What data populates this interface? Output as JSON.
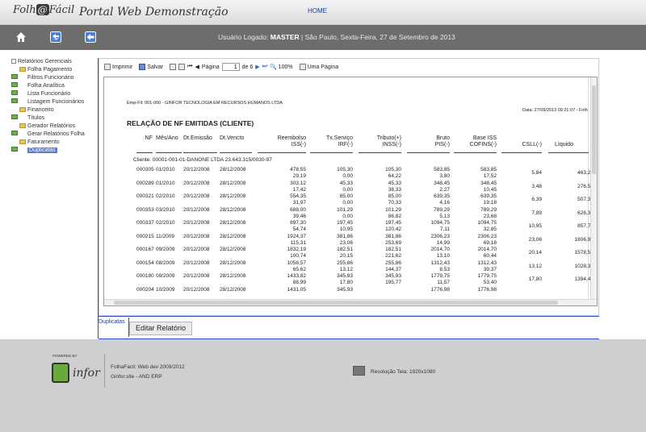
{
  "header": {
    "logo_left": "Folh",
    "logo_at": "@",
    "logo_right": "Fácil",
    "title": "Portal Web Demonstração",
    "home_label": "HOME"
  },
  "toolbar": {
    "logged_label": "Usuário Logado:",
    "user": "MASTER",
    "status_rest": "| São Paulo, Sexta-Feira, 27 de Setembro de 2013"
  },
  "sidebar": {
    "items": [
      {
        "label": "Relatórios Gerenciais",
        "level": 0,
        "icon": "report-icon"
      },
      {
        "label": "Folha Pagamento",
        "level": 1,
        "icon": "folder-icon"
      },
      {
        "label": "Filtros Funcionário",
        "level": 2,
        "icon": "doc-icon"
      },
      {
        "label": "Folha Analítica",
        "level": 2,
        "icon": "doc-icon"
      },
      {
        "label": "Lista Funcionário",
        "level": 2,
        "icon": "doc-icon"
      },
      {
        "label": "Listagem Funcionários",
        "level": 2,
        "icon": "doc-icon"
      },
      {
        "label": "Financeiro",
        "level": 1,
        "icon": "folder-icon"
      },
      {
        "label": "Títulos",
        "level": 2,
        "icon": "doc-icon"
      },
      {
        "label": "Gerador Relatórios",
        "level": 1,
        "icon": "folder-icon"
      },
      {
        "label": "Gerar Relatórios Folha",
        "level": 2,
        "icon": "doc-icon"
      },
      {
        "label": "Faturamento",
        "level": 1,
        "icon": "folder-icon"
      },
      {
        "label": "Duplicatas",
        "level": 2,
        "icon": "doc-icon",
        "selected": true
      }
    ]
  },
  "report_toolbar": {
    "print_label": "Imprimir",
    "save_label": "Salvar",
    "page_label": "Página",
    "page_value": "1",
    "of_label": "de 6",
    "zoom_label": "100%",
    "one_page_label": "Uma Página"
  },
  "report": {
    "emp_fil": "Emp-Fil: 001-000 - GINFOR TECNOLOGIA EM RECURSOS HUMANOS LTDA",
    "data_hora": "Data: 27/09/2013 09:21:07 - Folh",
    "title": "RELAÇÃO DE NF EMITIDAS (CLIENTE)",
    "columns": {
      "nf": "NF",
      "mes_ano": "Mês/Ano",
      "dt_emissao": "Dt.Emissão",
      "dt_vencto": "Dt.Vencto",
      "reembolso_1": "Reembolso",
      "reembolso_2": "ISS(-)",
      "tx_servico_1": "Tx.Serviço",
      "tx_servico_2": "IRF(-)",
      "tributo_1": "Tributo(+)",
      "tributo_2": "INSS(-)",
      "bruto_1": "Bruto",
      "bruto_2": "PIS(-)",
      "base_iss_1": "Base ISS",
      "base_iss_2": "COFINS(-)",
      "csll": "CSLL(-)",
      "liquido": "Líquido"
    },
    "client": "Cliente: 00001-001-01-DANONE LTDA 23.643.315/0030-97",
    "rows": [
      {
        "nf": "000305",
        "mes": "01/2010",
        "emissao": "20/12/2008",
        "vencto": "28/12/2008",
        "reembolso": "478,55",
        "iss": "29,19",
        "tx": "105,30",
        "irf": "0,00",
        "tributo": "105,30",
        "inss": "64,22",
        "bruto": "583,85",
        "pis": "3,80",
        "base": "583,85",
        "cofins": "17,52",
        "csll": "5,84",
        "liquido": "463,28"
      },
      {
        "nf": "000289",
        "mes": "01/2010",
        "emissao": "20/12/2008",
        "vencto": "28/12/2008",
        "reembolso": "303,12",
        "iss": "17,42",
        "tx": "45,33",
        "irf": "0,00",
        "tributo": "45,33",
        "inss": "38,33",
        "bruto": "348,45",
        "pis": "2,27",
        "base": "348,45",
        "cofins": "10,45",
        "csll": "3,48",
        "liquido": "276,50"
      },
      {
        "nf": "000321",
        "mes": "02/2010",
        "emissao": "20/12/2008",
        "vencto": "28/12/2008",
        "reembolso": "554,35",
        "iss": "31,97",
        "tx": "85,00",
        "irf": "0,00",
        "tributo": "85,00",
        "inss": "70,33",
        "bruto": "639,35",
        "pis": "4,16",
        "base": "639,35",
        "cofins": "19,18",
        "csll": "6,39",
        "liquido": "507,32"
      },
      {
        "nf": "000353",
        "mod": "",
        "mes": "03/2010",
        "emissao": "20/12/2008",
        "vencto": "28/12/2008",
        "reembolso": "688,00",
        "iss": "39,46",
        "tx": "101,29",
        "irf": "0,00",
        "tributo": "101,29",
        "inss": "86,82",
        "bruto": "789,29",
        "pis": "5,13",
        "base": "789,29",
        "cofins": "23,68",
        "csll": "7,89",
        "liquido": "626,31"
      },
      {
        "nf": "000337",
        "mes": "02/2010",
        "emissao": "20/12/2008",
        "vencto": "28/12/2008",
        "reembolso": "897,30",
        "iss": "54,74",
        "tx": "197,45",
        "irf": "10,95",
        "tributo": "197,45",
        "inss": "120,42",
        "bruto": "1094,75",
        "pis": "7,11",
        "base": "1094,75",
        "cofins": "32,85",
        "csll": "10,95",
        "liquido": "857,73"
      },
      {
        "nf": "000215",
        "mes": "11/2009",
        "emissao": "20/12/2008",
        "vencto": "28/12/2008",
        "reembolso": "1924,37",
        "iss": "115,31",
        "tx": "381,86",
        "irf": "23,06",
        "tributo": "381,86",
        "inss": "253,69",
        "bruto": "2306,23",
        "pis": "14,99",
        "base": "2306,23",
        "cofins": "69,18",
        "csll": "23,06",
        "liquido": "1806,94"
      },
      {
        "nf": "000167",
        "mes": "09/2009",
        "emissao": "20/12/2008",
        "vencto": "28/12/2008",
        "reembolso": "1832,19",
        "iss": "100,74",
        "tx": "182,51",
        "irf": "20,15",
        "tributo": "182,51",
        "inss": "221,62",
        "bruto": "2014,70",
        "pis": "13,10",
        "base": "2014,70",
        "cofins": "60,44",
        "csll": "20,14",
        "liquido": "1578,51"
      },
      {
        "nf": "000154",
        "mes": "08/2009",
        "emissao": "20/12/2008",
        "vencto": "28/12/2008",
        "reembolso": "1056,57",
        "iss": "65,62",
        "tx": "255,86",
        "irf": "13,12",
        "tributo": "255,86",
        "inss": "144,37",
        "bruto": "1312,43",
        "pis": "8,53",
        "base": "1312,43",
        "cofins": "39,37",
        "csll": "13,12",
        "liquido": "1028,30"
      },
      {
        "nf": "000180",
        "mes": "09/2009",
        "emissao": "20/12/2008",
        "vencto": "28/12/2008",
        "reembolso": "1433,82",
        "iss": "88,99",
        "tx": "345,93",
        "irf": "17,80",
        "tributo": "345,93",
        "inss": "195,77",
        "bruto": "1779,75",
        "pis": "11,57",
        "base": "1779,75",
        "cofins": "53,40",
        "csll": "17,80",
        "liquido": "1394,42"
      },
      {
        "nf": "000204",
        "mes": "10/2009",
        "emissao": "20/12/2008",
        "vencto": "28/12/2008",
        "reembolso": "1431,05",
        "iss": "",
        "tx": "345,93",
        "irf": "",
        "tributo": "",
        "inss": "",
        "bruto": "1776,98",
        "pis": "",
        "base": "1776,98",
        "cofins": "",
        "csll": "",
        "liquido": ""
      }
    ]
  },
  "bottom": {
    "tab_label": "Duplicatas",
    "edit_button": "Editar Relatório"
  },
  "footer": {
    "powered": "POWERED BY",
    "brand": "infor",
    "line1": "FolhaFacil: Web dev 2009/2012",
    "line2": "Ginfor.site - AND ERP",
    "resolution": "Resolução Tela: 1920x1080"
  }
}
